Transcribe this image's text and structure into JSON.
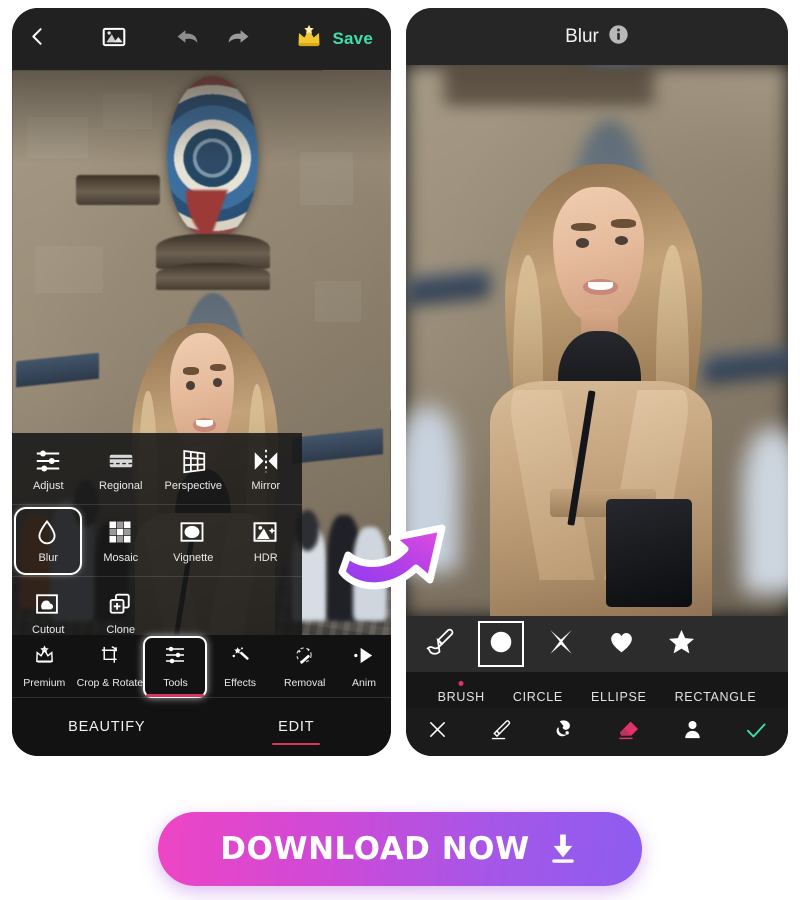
{
  "app": {
    "background_color": "#ffffff",
    "accent_pink": "#d9355f",
    "accent_green": "#3fe0a8",
    "panel_dark": "#1b1b1b"
  },
  "left_phone": {
    "topbar": {
      "back_icon": "chevron-left-icon",
      "gallery_icon": "photo-icon",
      "undo_icon": "undo-arrow-icon",
      "redo_icon": "redo-arrow-icon",
      "premium_icon": "crown-icon",
      "save_label": "Save"
    },
    "photo": {
      "alt": "Woman in beige coat and black turtleneck smiling in front of the Prague Astronomical Clock"
    },
    "tools_panel": {
      "rows": [
        [
          {
            "label": "Adjust",
            "icon": "sliders-icon",
            "selected": false
          },
          {
            "label": "Regional",
            "icon": "regional-brush-icon",
            "selected": false
          },
          {
            "label": "Perspective",
            "icon": "perspective-grid-icon",
            "selected": false
          },
          {
            "label": "Mirror",
            "icon": "mirror-icon",
            "selected": false
          }
        ],
        [
          {
            "label": "Blur",
            "icon": "droplet-icon",
            "selected": true
          },
          {
            "label": "Mosaic",
            "icon": "mosaic-grid-icon",
            "selected": false
          },
          {
            "label": "Vignette",
            "icon": "vignette-icon",
            "selected": false
          },
          {
            "label": "HDR",
            "icon": "hdr-photo-icon",
            "selected": false
          }
        ],
        [
          {
            "label": "Cutout",
            "icon": "cutout-icon",
            "selected": false
          },
          {
            "label": "Clone",
            "icon": "clone-plus-icon",
            "selected": false
          }
        ]
      ]
    },
    "bottom_tabs": [
      {
        "label": "Premium",
        "icon": "crown-outline-icon",
        "selected": false
      },
      {
        "label": "Crop & Rotate",
        "icon": "crop-rotate-icon",
        "selected": false
      },
      {
        "label": "Tools",
        "icon": "sliders-icon",
        "selected": true
      },
      {
        "label": "Effects",
        "icon": "magic-wand-icon",
        "selected": false
      },
      {
        "label": "Removal",
        "icon": "removal-wand-icon",
        "selected": false
      },
      {
        "label": "Anim",
        "icon": "animate-icon",
        "selected": false
      }
    ],
    "mode_bar": [
      {
        "label": "BEAUTIFY",
        "selected": false
      },
      {
        "label": "EDIT",
        "selected": true
      }
    ]
  },
  "right_phone": {
    "topbar": {
      "title": "Blur",
      "info_icon": "info-circle-icon"
    },
    "photo": {
      "alt": "Blurred-background portrait of the woman in the beige coat with black handbag"
    },
    "shape_tools": [
      {
        "name": "brush-tool",
        "icon": "paintbrush-icon",
        "selected": false
      },
      {
        "name": "circle-tool",
        "icon": "filled-circle-icon",
        "selected": true
      },
      {
        "name": "cross-tool",
        "icon": "cross-x-icon",
        "selected": false
      },
      {
        "name": "heart-tool",
        "icon": "heart-icon",
        "selected": false
      },
      {
        "name": "star-tool",
        "icon": "star-icon",
        "selected": false
      }
    ],
    "modes": [
      {
        "label": "BRUSH",
        "selected": true
      },
      {
        "label": "CIRCLE",
        "selected": false
      },
      {
        "label": "ELLIPSE",
        "selected": false
      },
      {
        "label": "RECTANGLE",
        "selected": false
      }
    ],
    "actions": [
      {
        "name": "cancel-action",
        "icon": "close-x-icon",
        "color": "#ffffff"
      },
      {
        "name": "brush-action",
        "icon": "brush-stroke-icon",
        "color": "#ffffff"
      },
      {
        "name": "smudge-action",
        "icon": "smudge-hand-icon",
        "color": "#ffffff"
      },
      {
        "name": "eraser-action",
        "icon": "eraser-icon",
        "color": "#e0336b"
      },
      {
        "name": "subject-action",
        "icon": "person-icon",
        "color": "#ffffff"
      },
      {
        "name": "confirm-action",
        "icon": "check-icon",
        "color": "#3fe0a8"
      }
    ]
  },
  "arrow": {
    "name": "curved-arrow",
    "color_start": "#8e3cf0",
    "color_end": "#e24ce0"
  },
  "download": {
    "label": "DOWNLOAD NOW",
    "icon": "download-icon"
  }
}
